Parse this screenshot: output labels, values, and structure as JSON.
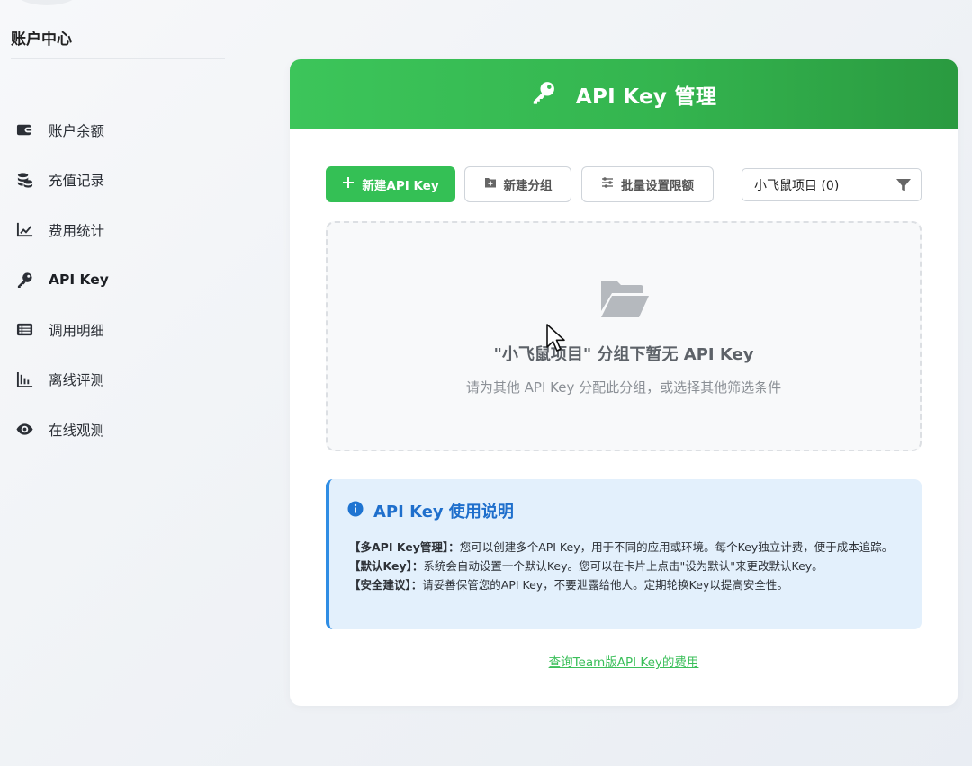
{
  "sidebar": {
    "title": "账户中心",
    "items": [
      {
        "label": "账户余额",
        "icon": "wallet-icon",
        "active": false
      },
      {
        "label": "充值记录",
        "icon": "coins-icon",
        "active": false
      },
      {
        "label": "费用统计",
        "icon": "line-chart-icon",
        "active": false
      },
      {
        "label": "API Key",
        "icon": "key-icon",
        "active": true
      },
      {
        "label": "调用明细",
        "icon": "list-icon",
        "active": false
      },
      {
        "label": "离线评测",
        "icon": "bar-chart-icon",
        "active": false
      },
      {
        "label": "在线观测",
        "icon": "eye-icon",
        "active": false
      }
    ]
  },
  "main": {
    "header": {
      "title": "API Key 管理",
      "icon": "key-icon"
    },
    "toolbar": {
      "new_key_label": "新建API Key",
      "new_group_label": "新建分组",
      "batch_limit_label": "批量设置限额",
      "group_select_value": "小飞鼠项目 (0)"
    },
    "empty_state": {
      "title": "\"小飞鼠项目\" 分组下暂无 API Key",
      "subtitle": "请为其他 API Key 分配此分组，或选择其他筛选条件"
    },
    "info_box": {
      "title": "API Key 使用说明",
      "lines": [
        {
          "label": "【多API Key管理】：",
          "text": "您可以创建多个API Key，用于不同的应用或环境。每个Key独立计费，便于成本追踪。"
        },
        {
          "label": "【默认Key】：",
          "text": "系统会自动设置一个默认Key。您可以在卡片上点击\"设为默认\"来更改默认Key。"
        },
        {
          "label": "【安全建议】：",
          "text": "请妥善保管您的API Key，不要泄露给他人。定期轮换Key以提高安全性。"
        }
      ]
    },
    "team_link": "查询Team版API Key的费用"
  },
  "colors": {
    "brand_green": "#34c055",
    "info_blue": "#1f6fcc",
    "info_bg": "#e3f0fc"
  }
}
